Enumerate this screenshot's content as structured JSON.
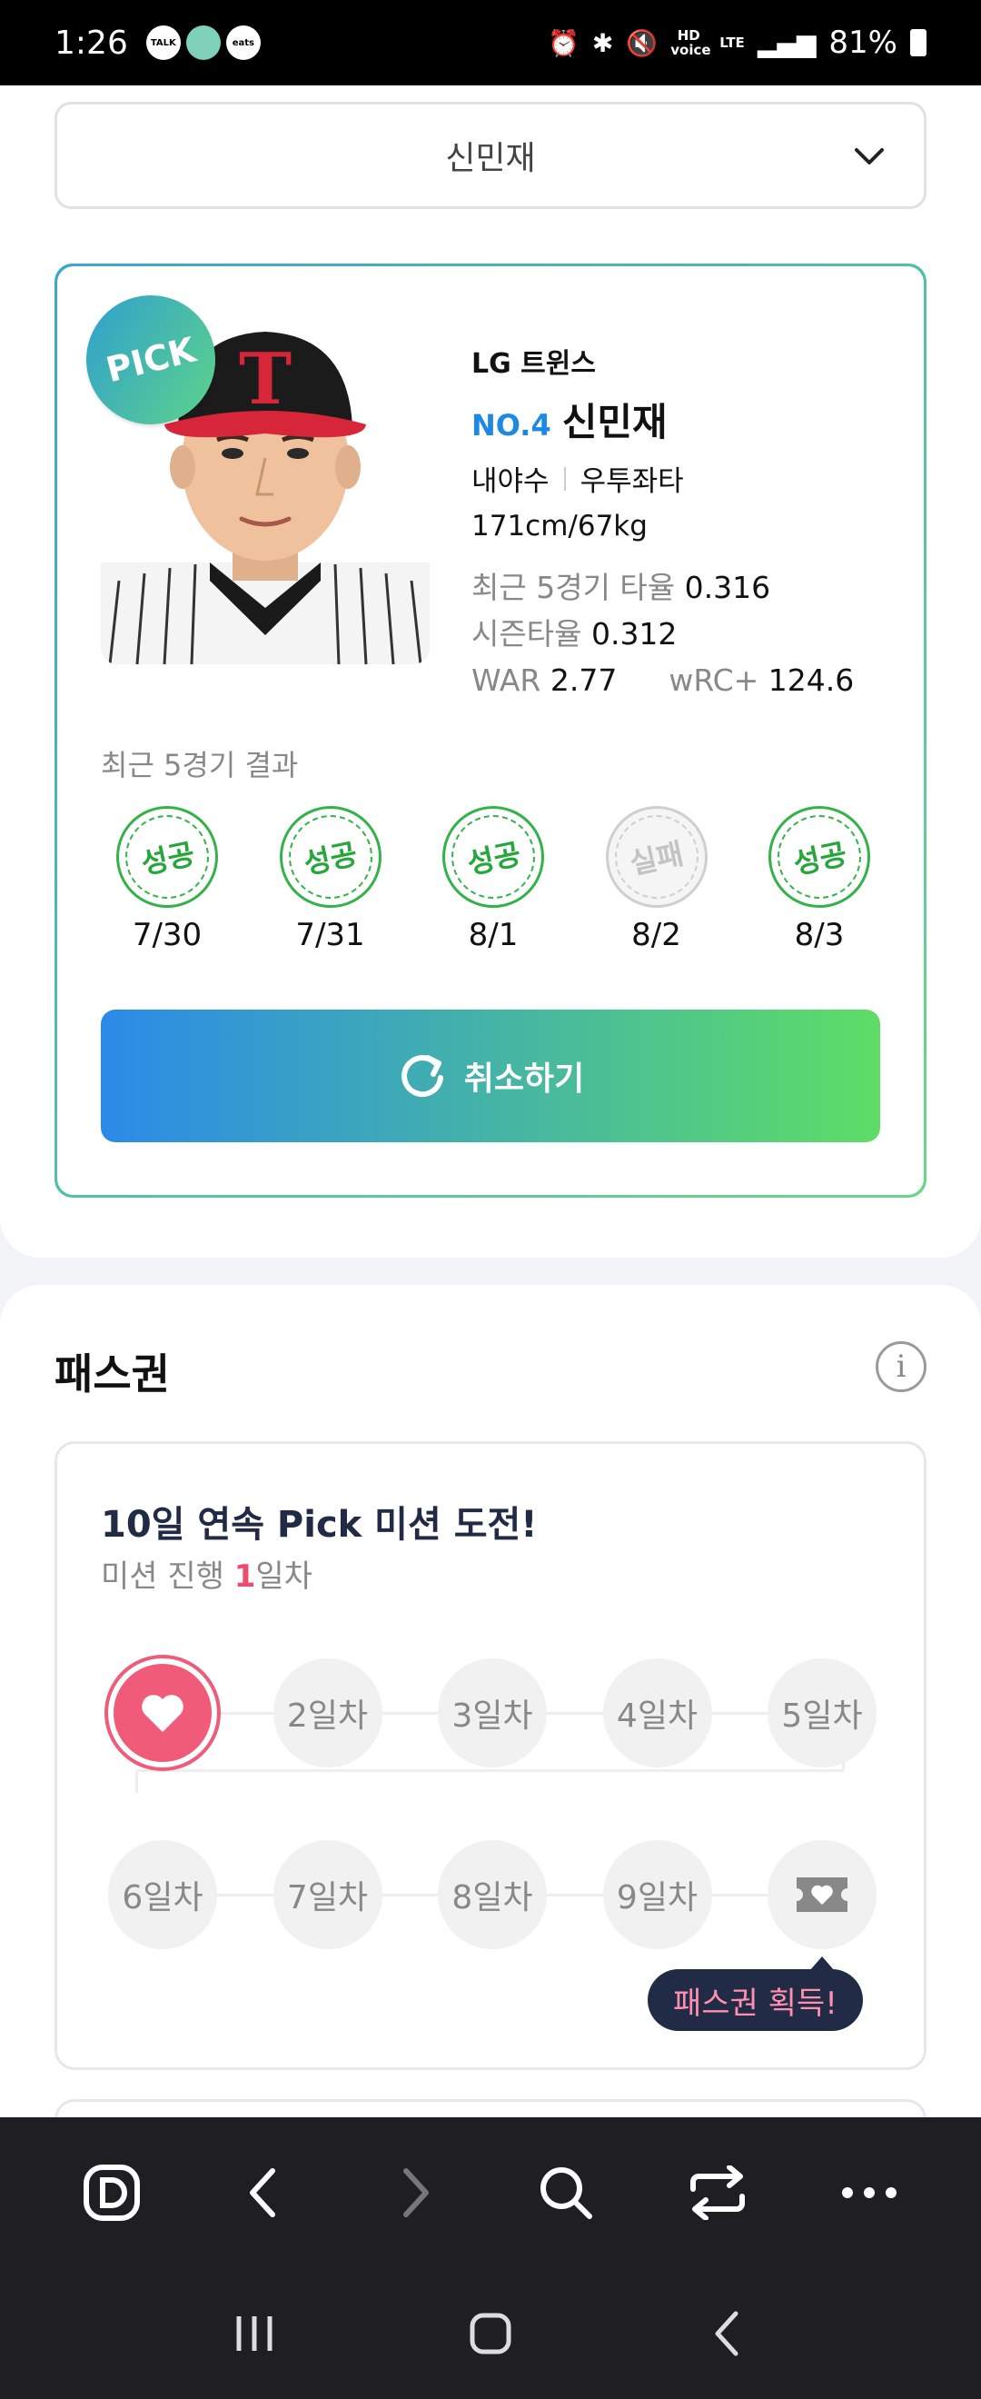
{
  "status_bar": {
    "time": "1:26",
    "notif_icons": [
      "TALK",
      "app",
      "eats"
    ],
    "hd_label": "HD voice",
    "lte_label": "LTE",
    "battery": "81%"
  },
  "selector": {
    "value": "신민재"
  },
  "player": {
    "pick_badge": "PICK",
    "team": "LG 트윈스",
    "number": "NO.4",
    "name": "신민재",
    "position": "내야수",
    "bats_throws": "우투좌타",
    "physical": "171cm/67kg",
    "stats": {
      "recent5_label": "최근 5경기 타율",
      "recent5_value": "0.316",
      "season_label": "시즌타율",
      "season_value": "0.312",
      "war_label": "WAR",
      "war_value": "2.77",
      "wrc_label": "wRC+",
      "wrc_value": "124.6"
    },
    "recent_results_label": "최근 5경기 결과",
    "results": [
      {
        "text": "성공",
        "date": "7/30",
        "success": true
      },
      {
        "text": "성공",
        "date": "7/31",
        "success": true
      },
      {
        "text": "성공",
        "date": "8/1",
        "success": true
      },
      {
        "text": "실패",
        "date": "8/2",
        "success": false
      },
      {
        "text": "성공",
        "date": "8/3",
        "success": true
      }
    ],
    "cancel_label": "취소하기"
  },
  "pass": {
    "title": "패스권",
    "mission_title": "10일 연속 Pick 미션 도전!",
    "mission_progress_prefix": "미션 진행 ",
    "mission_progress_day": "1",
    "mission_progress_suffix": "일차",
    "days_row1": [
      "2일차",
      "3일차",
      "4일차",
      "5일차"
    ],
    "days_row2": [
      "6일차",
      "7일차",
      "8일차",
      "9일차"
    ],
    "reward_tooltip": "패스권 획득!"
  },
  "colors": {
    "accent_blue": "#2b8ae8",
    "accent_green": "#5edd66",
    "success_green": "#34b24a",
    "pink": "#ef5b78",
    "navy": "#222b45"
  }
}
